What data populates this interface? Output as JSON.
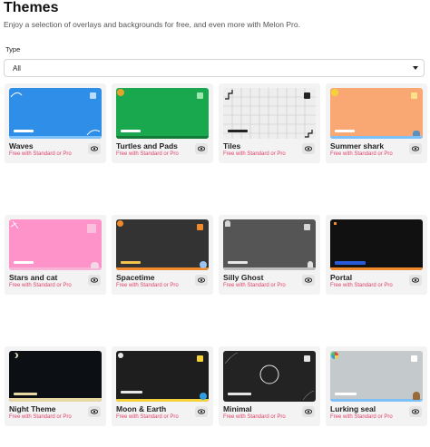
{
  "header": {
    "title": "Themes",
    "subtitle": "Enjoy a selection of overlays and backgrounds for free, and even more with Melon Pro."
  },
  "filter": {
    "label": "Type",
    "selected": "All"
  },
  "themes": [
    {
      "name": "Waves",
      "note": "Free with Standard or Pro"
    },
    {
      "name": "Turtles and Pads",
      "note": "Free with Standard or Pro"
    },
    {
      "name": "Tiles",
      "note": "Free with Standard or Pro"
    },
    {
      "name": "Summer shark",
      "note": "Free with Standard or Pro"
    },
    {
      "name": "Stars and cat",
      "note": "Free with Standard or Pro"
    },
    {
      "name": "Spacetime",
      "note": "Free with Standard or Pro"
    },
    {
      "name": "Silly Ghost",
      "note": "Free with Standard or Pro"
    },
    {
      "name": "Portal",
      "note": "Free with Standard or Pro"
    },
    {
      "name": "Night Theme",
      "note": "Free with Standard or Pro"
    },
    {
      "name": "Moon & Earth",
      "note": "Free with Standard or Pro"
    },
    {
      "name": "Minimal",
      "note": "Free with Standard or Pro"
    },
    {
      "name": "Lurking seal",
      "note": "Free with Standard or Pro"
    }
  ],
  "colors": {
    "waves": "#2f8ee8",
    "turtles": "#1aa84f",
    "tiles": "#eeeeee",
    "summer_shark": "#f9a874",
    "stars_cat": "#fd93c9",
    "spacetime": "#333333",
    "silly_ghost": "#555555",
    "portal": "#111111",
    "night": "#0c0f14",
    "moon_earth": "#1e1e1e",
    "minimal": "#232323",
    "lurking_seal": "#c4c9cc",
    "pro_note": "#e0436a"
  },
  "icons": {
    "preview": "eye-icon",
    "dropdown": "chevron-down-icon"
  }
}
